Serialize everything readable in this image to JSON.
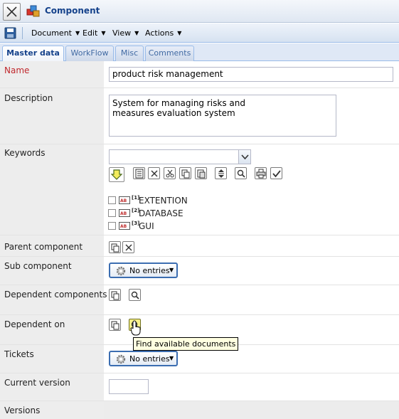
{
  "window": {
    "title": "Component",
    "close_icon": "close-x-icon",
    "app_icon": "component-cubes-icon"
  },
  "toolbar": {
    "save_icon": "save-disk-icon",
    "menus": [
      "Document",
      "Edit",
      "View",
      "Actions"
    ]
  },
  "tabs": [
    {
      "label": "Master data",
      "active": true
    },
    {
      "label": "WorkFlow",
      "active": false
    },
    {
      "label": "Misc",
      "active": false
    },
    {
      "label": "Comments",
      "active": false
    }
  ],
  "form": {
    "name": {
      "label": "Name",
      "value": "product risk management"
    },
    "description": {
      "label": "Description",
      "value": "System for managing risks and\nmeasures evaluation system"
    },
    "keywords": {
      "label": "Keywords",
      "input_value": "",
      "items": [
        {
          "num": "[1]",
          "text": "EXTENTION"
        },
        {
          "num": "[2]",
          "text": "DATABASE"
        },
        {
          "num": "[3]",
          "text": "GUI"
        }
      ]
    },
    "parent_component": {
      "label": "Parent component"
    },
    "sub_component": {
      "label": "Sub component",
      "button": "No entries"
    },
    "dependent_components": {
      "label": "Dependent components"
    },
    "dependent_on": {
      "label": "Dependent on",
      "tooltip": "Find available documents"
    },
    "tickets": {
      "label": "Tickets",
      "button": "No entries"
    },
    "current_version": {
      "label": "Current version",
      "value": ""
    },
    "versions": {
      "label": "Versions"
    }
  },
  "colors": {
    "accent": "#15428b",
    "required_label": "#c0282d",
    "tooltip_bg": "#ffffe1",
    "label_column_bg": "#ededed"
  }
}
